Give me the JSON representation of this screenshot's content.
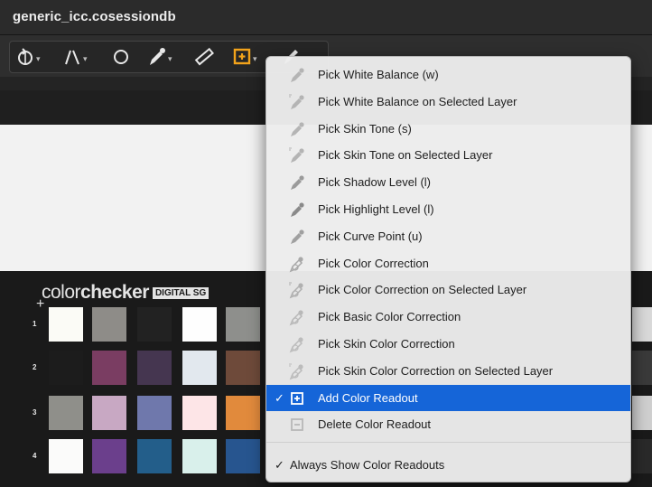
{
  "window": {
    "title": "generic_icc.cosessiondb"
  },
  "toolbar": {
    "tools": [
      {
        "icon": "rotate-icon"
      },
      {
        "icon": "keystone-icon"
      },
      {
        "icon": "circle-icon"
      },
      {
        "icon": "eyedropper-icon"
      },
      {
        "icon": "ruler-icon"
      },
      {
        "icon": "color-readout-icon"
      },
      {
        "icon": "pencil-icon"
      }
    ]
  },
  "checker": {
    "brand_light": "color",
    "brand_bold": "checker",
    "brand_tag": "DIGITAL SG",
    "rows": [
      "1",
      "2",
      "3",
      "4"
    ],
    "patch_colors": [
      [
        "#fbfbf6",
        "#8e8c88",
        "#222222",
        "#fefefe",
        "#8e8f8c"
      ],
      [
        "#1c1c1c",
        "#7a3d62",
        "#453650",
        "#e2e8ee",
        "#6e4a3a"
      ],
      [
        "#8f8f8a",
        "#c8a8c3",
        "#6f78ac",
        "#fde5e7",
        "#e18a3c"
      ],
      [
        "#fbfbfa",
        "#6b3f8c",
        "#235e8a",
        "#d9f0eb",
        "#27558f"
      ]
    ]
  },
  "menu": {
    "accent": "#1565d8",
    "items": [
      {
        "label": "Pick White Balance (w)",
        "icon": "eyedropper-icon",
        "checked": false,
        "selected": false
      },
      {
        "label": "Pick White Balance on Selected Layer",
        "icon": "eyedropper-layer-icon",
        "checked": false,
        "selected": false
      },
      {
        "label": "Pick Skin Tone (s)",
        "icon": "skin-tone-icon",
        "checked": false,
        "selected": false
      },
      {
        "label": "Pick Skin Tone on Selected Layer",
        "icon": "skin-tone-layer-icon",
        "checked": false,
        "selected": false
      },
      {
        "label": "Pick Shadow Level (l)",
        "icon": "shadow-dropper-icon",
        "checked": false,
        "selected": false
      },
      {
        "label": "Pick Highlight Level (l)",
        "icon": "highlight-dropper-icon",
        "checked": false,
        "selected": false
      },
      {
        "label": "Pick Curve Point (u)",
        "icon": "curve-point-icon",
        "checked": false,
        "selected": false
      },
      {
        "label": "Pick Color Correction",
        "icon": "color-correction-icon",
        "checked": false,
        "selected": false
      },
      {
        "label": "Pick Color Correction on Selected Layer",
        "icon": "color-correction-layer-icon",
        "checked": false,
        "selected": false
      },
      {
        "label": "Pick Basic Color Correction",
        "icon": "basic-color-correction-icon",
        "checked": false,
        "selected": false
      },
      {
        "label": "Pick Skin Color Correction",
        "icon": "skin-color-correction-icon",
        "checked": false,
        "selected": false
      },
      {
        "label": "Pick Skin Color Correction on Selected Layer",
        "icon": "skin-color-correction-layer-icon",
        "checked": false,
        "selected": false
      },
      {
        "label": "Add Color Readout",
        "icon": "add-readout-icon",
        "checked": true,
        "selected": true,
        "check_glyph": "✓"
      },
      {
        "label": "Delete Color Readout",
        "icon": "delete-readout-icon",
        "checked": false,
        "selected": false
      }
    ],
    "bottom_item": {
      "label": "Always Show Color Readouts",
      "checked": true,
      "check_glyph": "✓"
    }
  }
}
